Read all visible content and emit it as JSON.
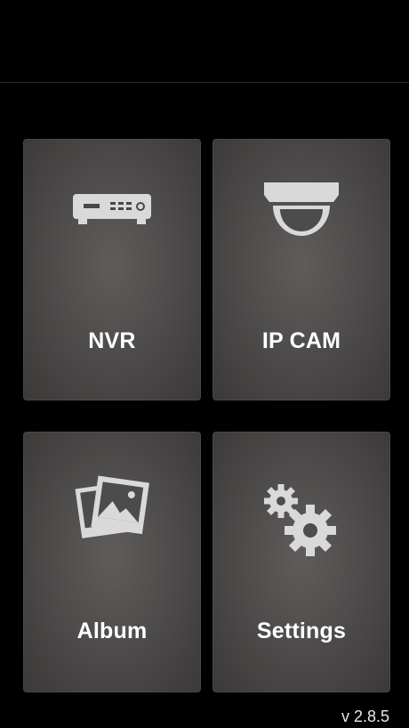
{
  "menu": {
    "tiles": [
      {
        "label": "NVR",
        "icon": "nvr-recorder-icon"
      },
      {
        "label": "IP CAM",
        "icon": "dome-camera-icon"
      },
      {
        "label": "Album",
        "icon": "photo-album-icon"
      },
      {
        "label": "Settings",
        "icon": "gears-icon"
      }
    ]
  },
  "footer": {
    "version": "v 2.8.5"
  },
  "colors": {
    "background": "#000000",
    "tile": "#4f4d4c",
    "icon": "#d9d9d9",
    "text": "#ffffff"
  }
}
